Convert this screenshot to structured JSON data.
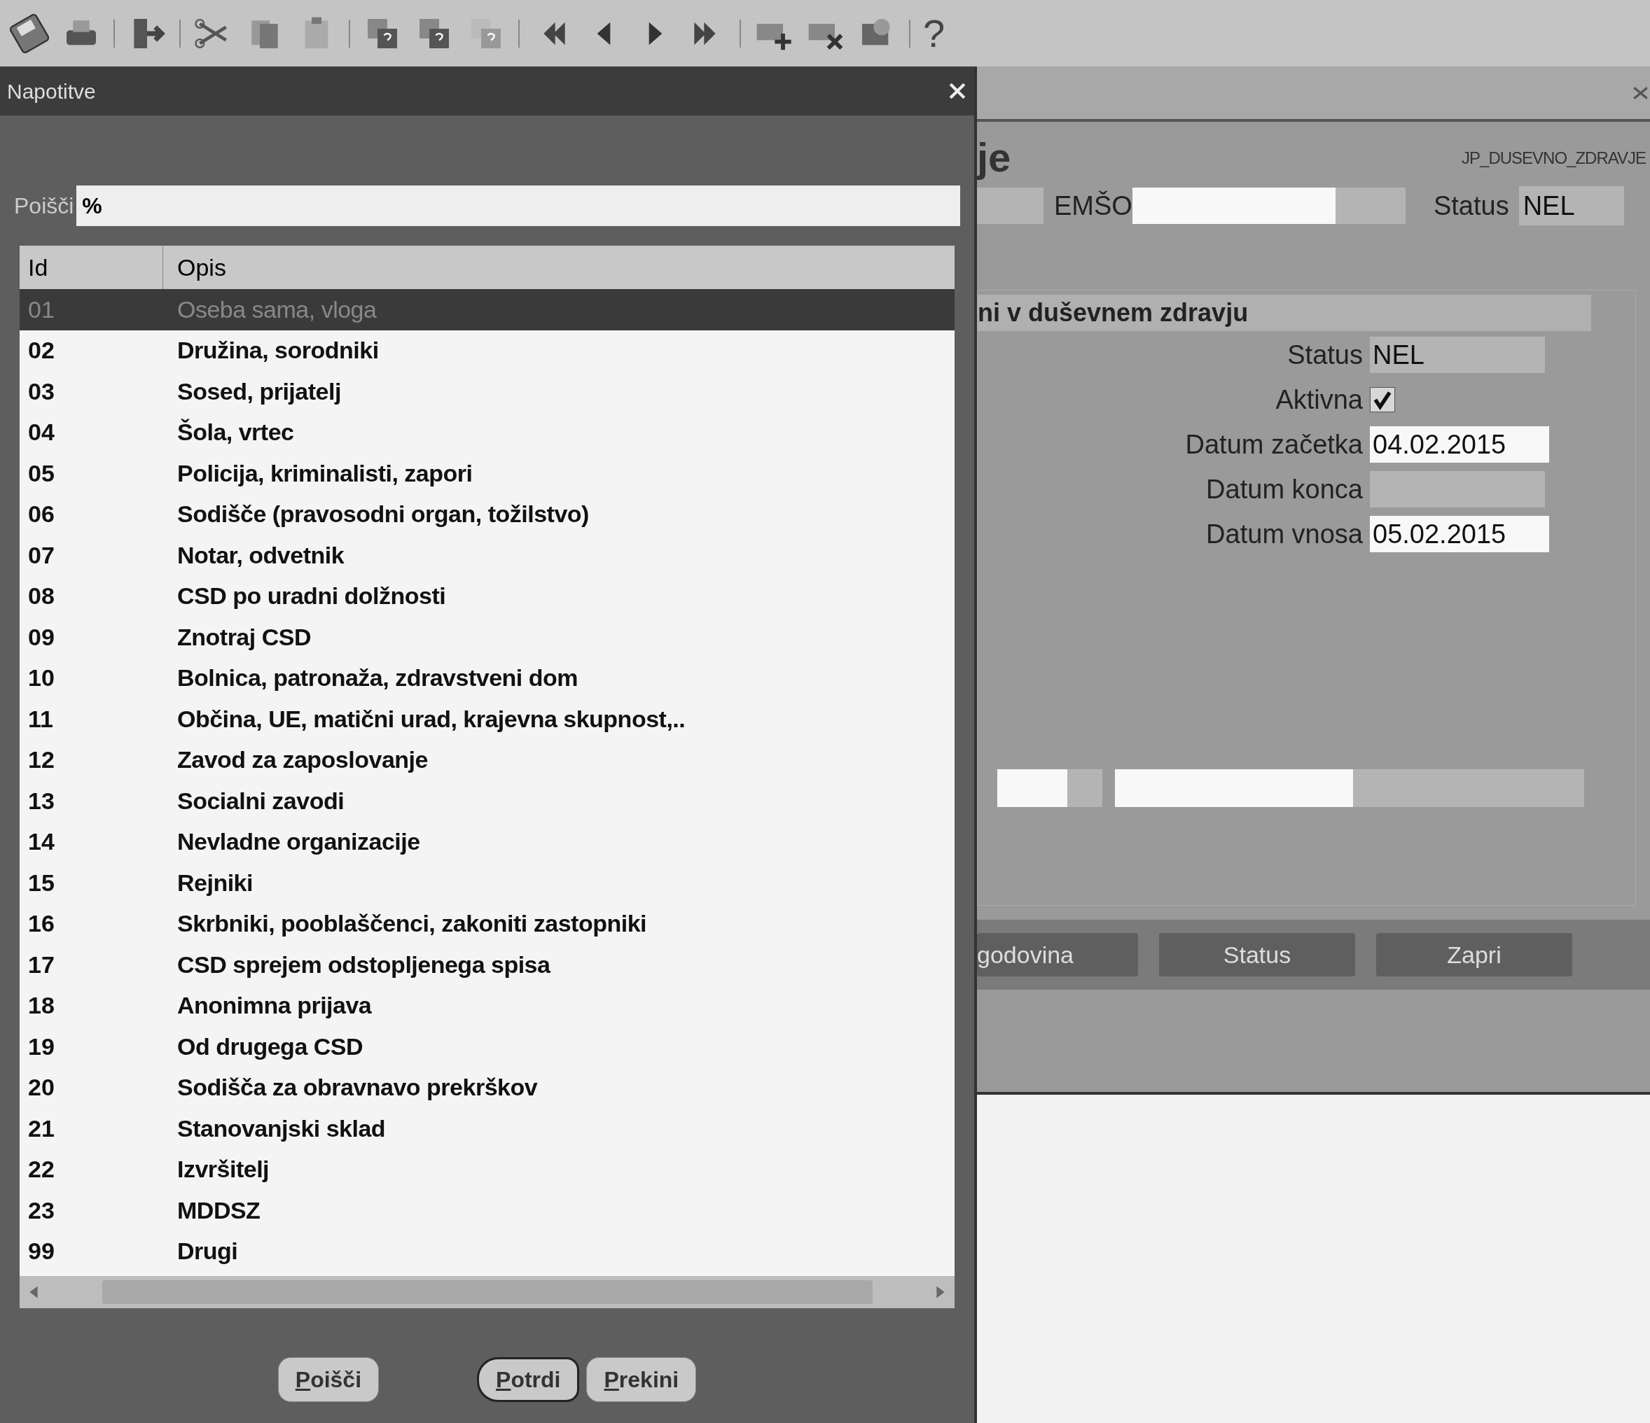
{
  "toolbar": {
    "help": "?"
  },
  "dialog": {
    "title": "Napotitve",
    "search": {
      "label": "Poišči",
      "value": "%"
    },
    "table": {
      "columns": [
        "Id",
        "Opis"
      ],
      "rows": [
        {
          "id": "01",
          "text": "Oseba sama, vloga",
          "selected": true
        },
        {
          "id": "02",
          "text": "Družina, sorodniki",
          "selected": false
        },
        {
          "id": "03",
          "text": "Sosed, prijatelj",
          "selected": false
        },
        {
          "id": "04",
          "text": "Šola, vrtec",
          "selected": false
        },
        {
          "id": "05",
          "text": "Policija, kriminalisti, zapori",
          "selected": false
        },
        {
          "id": "06",
          "text": "Sodišče (pravosodni organ, tožilstvo)",
          "selected": false
        },
        {
          "id": "07",
          "text": "Notar, odvetnik",
          "selected": false
        },
        {
          "id": "08",
          "text": "CSD po uradni dolžnosti",
          "selected": false
        },
        {
          "id": "09",
          "text": "Znotraj CSD",
          "selected": false
        },
        {
          "id": "10",
          "text": "Bolnica, patronaža, zdravstveni dom",
          "selected": false
        },
        {
          "id": "11",
          "text": "Občina, UE, matični urad, krajevna skupnost,..",
          "selected": false
        },
        {
          "id": "12",
          "text": "Zavod za zaposlovanje",
          "selected": false
        },
        {
          "id": "13",
          "text": "Socialni zavodi",
          "selected": false
        },
        {
          "id": "14",
          "text": "Nevladne organizacije",
          "selected": false
        },
        {
          "id": "15",
          "text": "Rejniki",
          "selected": false
        },
        {
          "id": "16",
          "text": "Skrbniki, pooblaščenci, zakoniti zastopniki",
          "selected": false
        },
        {
          "id": "17",
          "text": "CSD sprejem odstopljenega spisa",
          "selected": false
        },
        {
          "id": "18",
          "text": "Anonimna prijava",
          "selected": false
        },
        {
          "id": "19",
          "text": "Od drugega CSD",
          "selected": false
        },
        {
          "id": "20",
          "text": "Sodišča za obravnavo prekrškov",
          "selected": false
        },
        {
          "id": "21",
          "text": "Stanovanjski sklad",
          "selected": false
        },
        {
          "id": "22",
          "text": "Izvršitelj",
          "selected": false
        },
        {
          "id": "23",
          "text": "MDDSZ",
          "selected": false
        },
        {
          "id": "99",
          "text": "Drugi",
          "selected": false
        }
      ]
    },
    "buttons": [
      {
        "label": "Poišči",
        "default": false
      },
      {
        "label": "Potrdi",
        "default": true
      },
      {
        "label": "Prekini",
        "default": false
      }
    ]
  },
  "form": {
    "heading": "je",
    "form_name": "JP_DUSEVNO_ZDRAVJE",
    "emso_label": "EMŠO",
    "status_label": "Status",
    "status_value": "NEL",
    "section_title": "ni v duševnem zdravju",
    "fields": [
      {
        "kind": "text",
        "label": "Status",
        "value": "NEL",
        "editable": false
      },
      {
        "kind": "checkbox",
        "label": "Aktivna",
        "checked": true
      },
      {
        "kind": "text",
        "label": "Datum začetka",
        "value": "04.02.2015",
        "editable": true
      },
      {
        "kind": "text",
        "label": "Datum konca",
        "editable": false
      },
      {
        "kind": "text",
        "label": "Datum vnosa",
        "value": "05.02.2015",
        "editable": true
      }
    ],
    "buttons": [
      "godovina",
      "Status",
      "Zapri"
    ]
  }
}
